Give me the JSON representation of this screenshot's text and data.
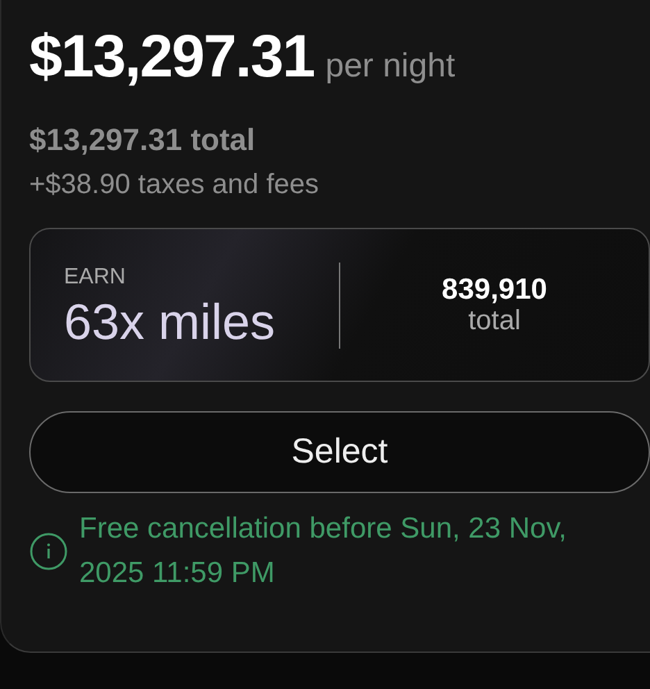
{
  "price": {
    "amount": "$13,297.31",
    "unit": "per night"
  },
  "total": "$13,297.31 total",
  "taxes": "+$38.90 taxes and fees",
  "earn": {
    "label": "EARN",
    "rate": "63x miles",
    "amount": "839,910",
    "amount_label": "total"
  },
  "button": "Select",
  "cancellation": "Free cancellation before Sun, 23 Nov, 2025 11:59 PM"
}
